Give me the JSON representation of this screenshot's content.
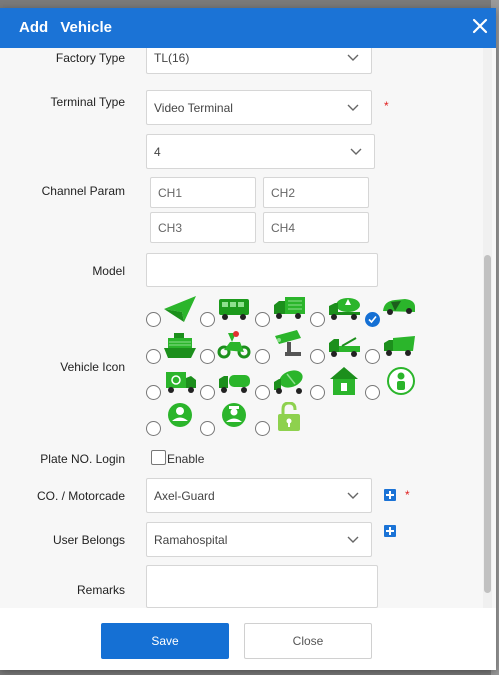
{
  "dialog": {
    "title": "Add Vehicle"
  },
  "form": {
    "factory_type": {
      "label": "Factory Type",
      "value": "TL(16)"
    },
    "terminal_type": {
      "label": "Terminal Type",
      "value": "Video Terminal",
      "required": "*"
    },
    "channel_count": {
      "value": "4"
    },
    "channel_param": {
      "label": "Channel Param",
      "channels": [
        "CH1",
        "CH2",
        "CH3",
        "CH4"
      ]
    },
    "model": {
      "label": "Model",
      "value": ""
    },
    "vehicle_icon": {
      "label": "Vehicle Icon",
      "icons": [
        "arrow-icon",
        "bus-icon",
        "truck-icon",
        "tanker-icon",
        "car-icon",
        "ship-icon",
        "scooter-icon",
        "camera-icon",
        "tow-truck-icon",
        "garbage-truck-icon",
        "recycle-truck-icon",
        "water-truck-icon",
        "mixer-truck-icon",
        "house-icon",
        "person-icon",
        "person-circle-icon",
        "police-icon",
        "lock-icon"
      ],
      "selected": "car-icon",
      "color": "#2bb52b"
    },
    "plate_login": {
      "label": "Plate NO. Login",
      "option": "Enable"
    },
    "company": {
      "label": "CO. / Motorcade",
      "value": "Axel-Guard",
      "required": "*"
    },
    "user_belongs": {
      "label": "User Belongs",
      "value": "Ramahospital"
    },
    "remarks": {
      "label": "Remarks",
      "value": ""
    }
  },
  "buttons": {
    "save": "Save",
    "close": "Close"
  },
  "colors": {
    "header": "#1b73d6",
    "primary": "#1570d4",
    "required": "#e02020"
  }
}
